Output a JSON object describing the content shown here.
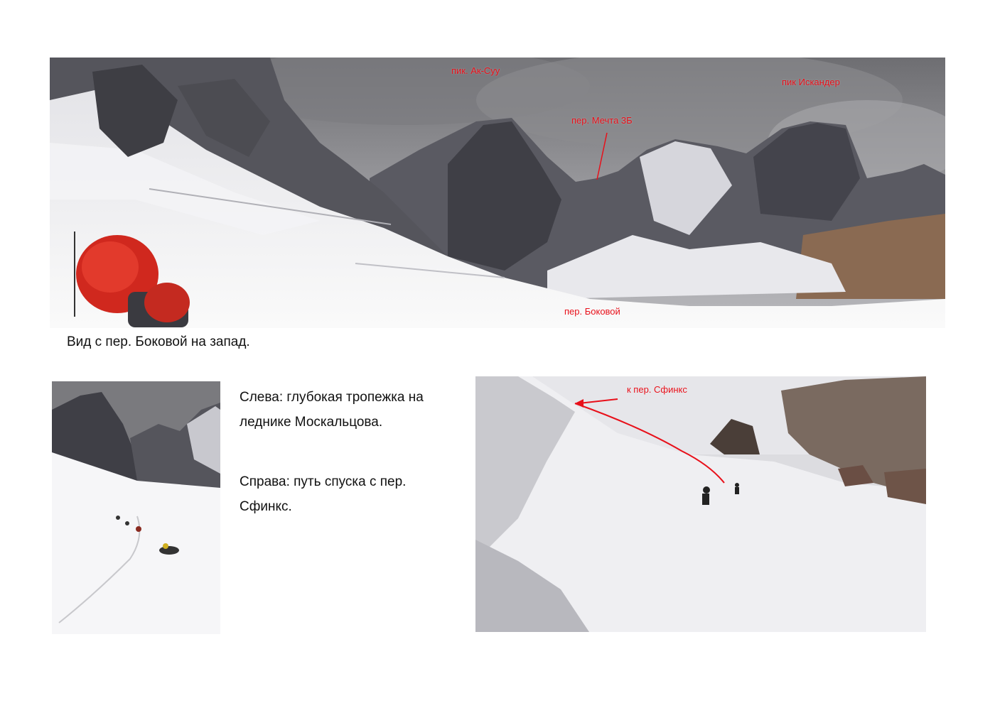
{
  "panorama": {
    "labels": {
      "ak_suu": "пик. Ак-Суу",
      "iskander": "пик Искандер",
      "mechta": "пер. Мечта 3Б",
      "bokovoy": "пер. Боковой"
    },
    "caption": "Вид с пер. Боковой на запад."
  },
  "descent_photo": {
    "label": "к пер. Сфинкс"
  },
  "text_block": {
    "left_text": "Слева: глубокая тропежка на леднике Москальцова.",
    "right_text": "Справа: путь спуска с пер. Сфинкс."
  },
  "colors": {
    "annotation": "#e8101a",
    "sky": "#8a8a8a",
    "snow": "#f2f2f4",
    "rock": "#4a4a52"
  }
}
